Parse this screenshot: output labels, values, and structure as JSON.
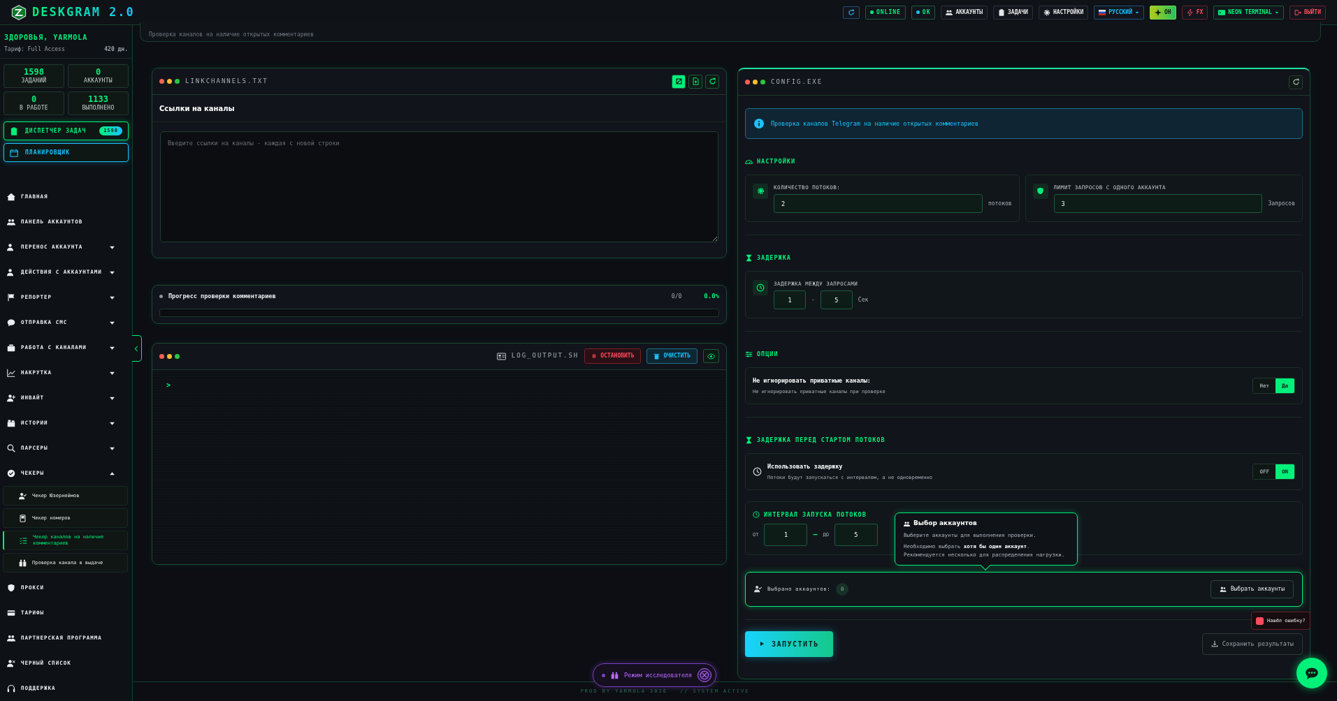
{
  "app": {
    "title": "DESKGRAM 2.0"
  },
  "top_bar": {
    "buttons": [
      {
        "kind": "icon"
      },
      {
        "kind": "status",
        "label": "ONLINE",
        "color": "#00f07a"
      },
      {
        "kind": "status",
        "label": "OK",
        "color": "#19c3ff"
      },
      {
        "kind": "plain",
        "label": "АККАУНТЫ"
      },
      {
        "kind": "plain",
        "label": "ЗАДАЧИ"
      },
      {
        "kind": "plain",
        "label": "НАСТРОЙКИ"
      },
      {
        "kind": "language",
        "label": "РУССКИЙ"
      },
      {
        "kind": "accent",
        "label": "ОН"
      },
      {
        "kind": "danger",
        "label": "FX"
      },
      {
        "kind": "theme",
        "label": "NEON TERMINAL"
      },
      {
        "kind": "danger",
        "label": "ВЫЙТИ"
      }
    ]
  },
  "user": {
    "greeting": "ЗДОРОВЬЯ, YARMOLA",
    "plan": "Тариф: Full Access",
    "days_left": "420 дн."
  },
  "stats": [
    {
      "value": "1598",
      "label": "ЗАДАНИЙ"
    },
    {
      "value": "0",
      "label": "АККАУНТЫ"
    },
    {
      "value": "0",
      "label": "В РАБОТЕ"
    },
    {
      "value": "1133",
      "label": "ВЫПОЛНЕНО"
    }
  ],
  "quick_buttons": [
    {
      "kind": "primary",
      "label": "ДИСПЕТЧЕР ЗАДАЧ",
      "badge": "1598"
    },
    {
      "kind": "secondary",
      "label": "ПЛАНИРОВЩИК"
    }
  ],
  "sidebar": {
    "items": [
      {
        "kind": "link",
        "label": "ГЛАВНАЯ"
      },
      {
        "kind": "link",
        "label": "ПАНЕЛЬ АККАУНТОВ"
      },
      {
        "kind": "group",
        "label": "ПЕРЕНОС АККАУНТА",
        "expanded": false
      },
      {
        "kind": "group",
        "label": "ДЕЙСТВИЯ С АККАУНТАМИ",
        "expanded": false
      },
      {
        "kind": "group",
        "label": "РЕПОРТЕР",
        "expanded": false
      },
      {
        "kind": "group",
        "label": "ОТПРАВКА СМС",
        "expanded": false
      },
      {
        "kind": "group",
        "label": "РАБОТА С КАНАЛАМИ",
        "expanded": false
      },
      {
        "kind": "group",
        "label": "НАКРУТКА",
        "expanded": false
      },
      {
        "kind": "group",
        "label": "ИНВАЙТ",
        "expanded": false
      },
      {
        "kind": "group",
        "label": "ИСТОРИИ",
        "expanded": false
      },
      {
        "kind": "group",
        "label": "ПАРСЕРЫ",
        "expanded": false
      },
      {
        "kind": "group",
        "label": "ЧЕКЕРЫ",
        "expanded": true,
        "children": [
          {
            "label": "Чекер Юзернеймов",
            "selected": false
          },
          {
            "label": "Чекер номеров",
            "selected": false
          },
          {
            "label": "Чекер каналов на наличие комментариев",
            "selected": true
          },
          {
            "label": "Проверка канала в выдаче",
            "selected": false
          }
        ]
      },
      {
        "kind": "link",
        "label": "ПРОКСИ"
      },
      {
        "kind": "link",
        "label": "ТАРИФЫ"
      },
      {
        "kind": "link",
        "label": "ПАРТНЕРСКАЯ ПРОГРАММА"
      },
      {
        "kind": "link",
        "label": "ЧЕРНЫЙ СПИСОК"
      },
      {
        "kind": "link",
        "label": "ПОДДЕРЖКА"
      }
    ]
  },
  "top_card": {
    "text": "Проверка каналов на наличие открытых комментариев"
  },
  "links_panel": {
    "file": "LINKCHANNELS.TXT",
    "title": "Ссылки на каналы",
    "placeholder": "Введите ссылки на каналы - каждая с новой строки"
  },
  "progress": {
    "title": "Прогресс проверки комментариев",
    "count": "0/0",
    "percent": "0.0%",
    "level": 0
  },
  "log": {
    "file": "LOG_OUTPUT.SH",
    "stop": "ОСТАНОВИТЬ",
    "clear": "ОЧИСТИТЬ",
    "prompt": ">"
  },
  "config": {
    "file": "CONFIG.EXE",
    "info": "Проверка каналов Telegram на наличие открытых комментариев",
    "settings": {
      "heading": "НАСТРОЙКИ",
      "fields": [
        {
          "label": "КОЛИЧЕСТВО ПОТОКОВ:",
          "value": "2",
          "unit": "потоков"
        },
        {
          "label": "ЛИМИТ ЗАПРОСОВ С ОДНОГО АККАУНТА",
          "value": "3",
          "unit": "Запросов"
        }
      ]
    },
    "delay": {
      "heading": "ЗАДЕРЖКА",
      "label": "ЗАДЕРЖКА МЕЖДУ ЗАПРОСАМИ",
      "from": "1",
      "separator": "-",
      "to": "5",
      "unit": "Сек"
    },
    "options": {
      "heading": "ОПЦИИ",
      "items": [
        {
          "title": "Не игнорировать приватные каналы:",
          "description": "Не игнорировать приватные каналы при проверке",
          "choices": [
            {
              "label": "Нет",
              "selected": false
            },
            {
              "label": "Да",
              "selected": true
            }
          ]
        }
      ]
    },
    "start_delay": {
      "heading": "ЗАДЕРЖКА ПЕРЕД СТАРТОМ ПОТОКОВ",
      "title": "Использовать задержку",
      "description": "Потоки будут запускаться с интервалом, а не одновременно",
      "choices": [
        {
          "label": "OFF",
          "selected": false
        },
        {
          "label": "ON",
          "selected": true
        }
      ],
      "interval": {
        "heading": "ИНТЕРВАЛ ЗАПУСКА ПОТОКОВ",
        "from_label": "ОТ",
        "from": "1",
        "dash": "—",
        "to_label": "ДО",
        "to": "5"
      }
    },
    "accounts": {
      "label": "Выбрано аккаунтов:",
      "count": "0",
      "button": "Выбрать аккаунты"
    },
    "actions": {
      "run": "ЗАПУСТИТЬ",
      "save": "Сохранить результаты"
    }
  },
  "tooltip": {
    "title": "Выбор аккаунтов",
    "lines": [
      "Выберите аккаунты для выполнения проверки.",
      "Необходимо выбрать **хотя бы один аккаунт**. Рекомендуется несколько для распределения нагрузки."
    ]
  },
  "explorer_mode": {
    "label": "Режим исследователя"
  },
  "bug_report": {
    "label": "Нашёл ошибку?"
  },
  "footer": {
    "credit": "PROD BY YARMOLA 2026",
    "status": "// SYSTEM ACTIVE"
  }
}
